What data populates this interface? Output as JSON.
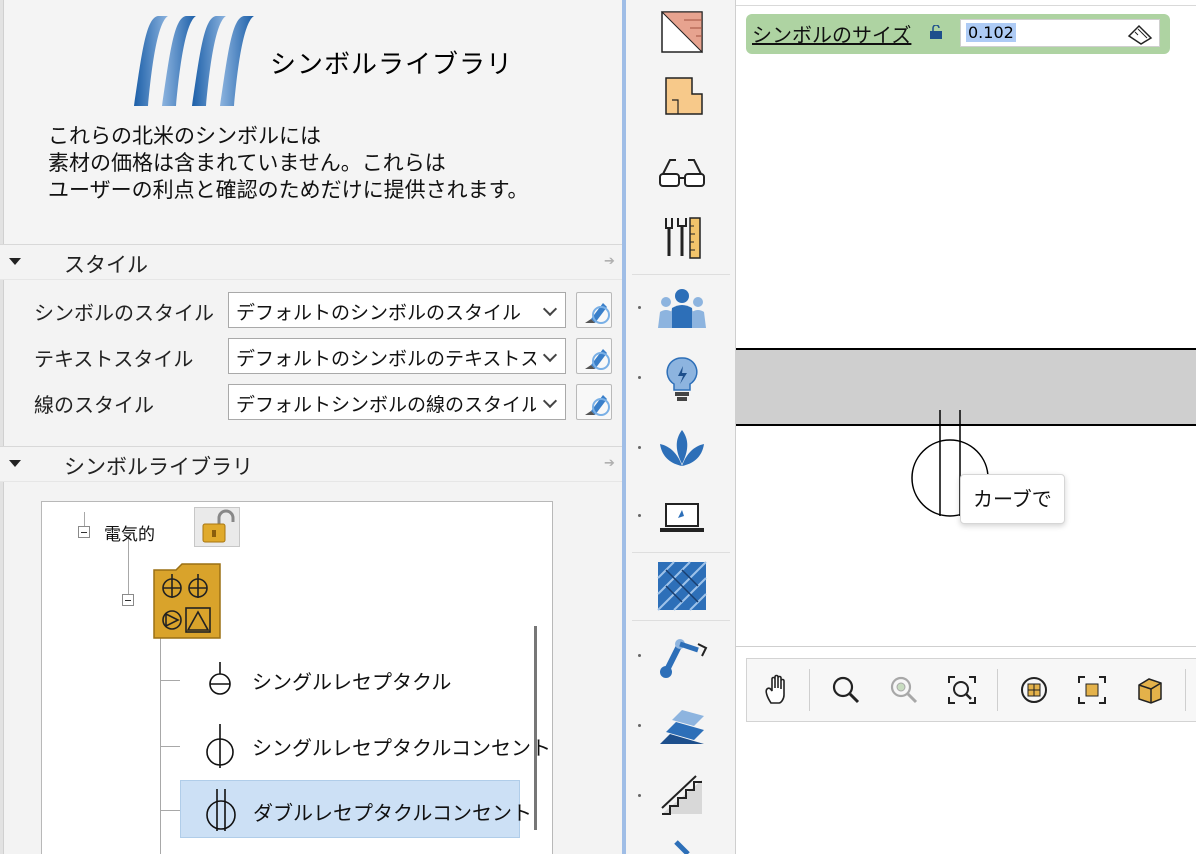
{
  "header": {
    "app_title": "シンボルライブラリ",
    "disclaimer": [
      "これらの北米のシンボルには",
      "素材の価格は含まれていません。これらは",
      "ユーザーの利点と確認のためだけに提供されます。"
    ]
  },
  "style_section": {
    "title": "スタイル",
    "rows": [
      {
        "label": "シンボルのスタイル",
        "value": "デフォルトのシンボルのスタイル"
      },
      {
        "label": "テキストスタイル",
        "value": "デフォルトのシンボルのテキストスタイル"
      },
      {
        "label": "線のスタイル",
        "value": "デフォルトシンボルの線のスタイル"
      }
    ]
  },
  "library_section": {
    "title": "シンボルライブラリ",
    "tree": {
      "root_label": "電気的",
      "items": [
        {
          "label": "シングルレセプタクル"
        },
        {
          "label": "シングルレセプタクルコンセント"
        },
        {
          "label": "ダブルレセプタクルコンセント",
          "selected": true
        }
      ]
    }
  },
  "canvas": {
    "size_label": "シンボルのサイズ",
    "size_value": "0.102",
    "tooltip": "カーブで"
  },
  "colors": {
    "accent_splitter": "#9fbde6",
    "size_bar": "#aed3a2",
    "selection": "#cce0f5",
    "logo_blue": "#2f6fba",
    "folder_gold": "#d9a32b"
  }
}
